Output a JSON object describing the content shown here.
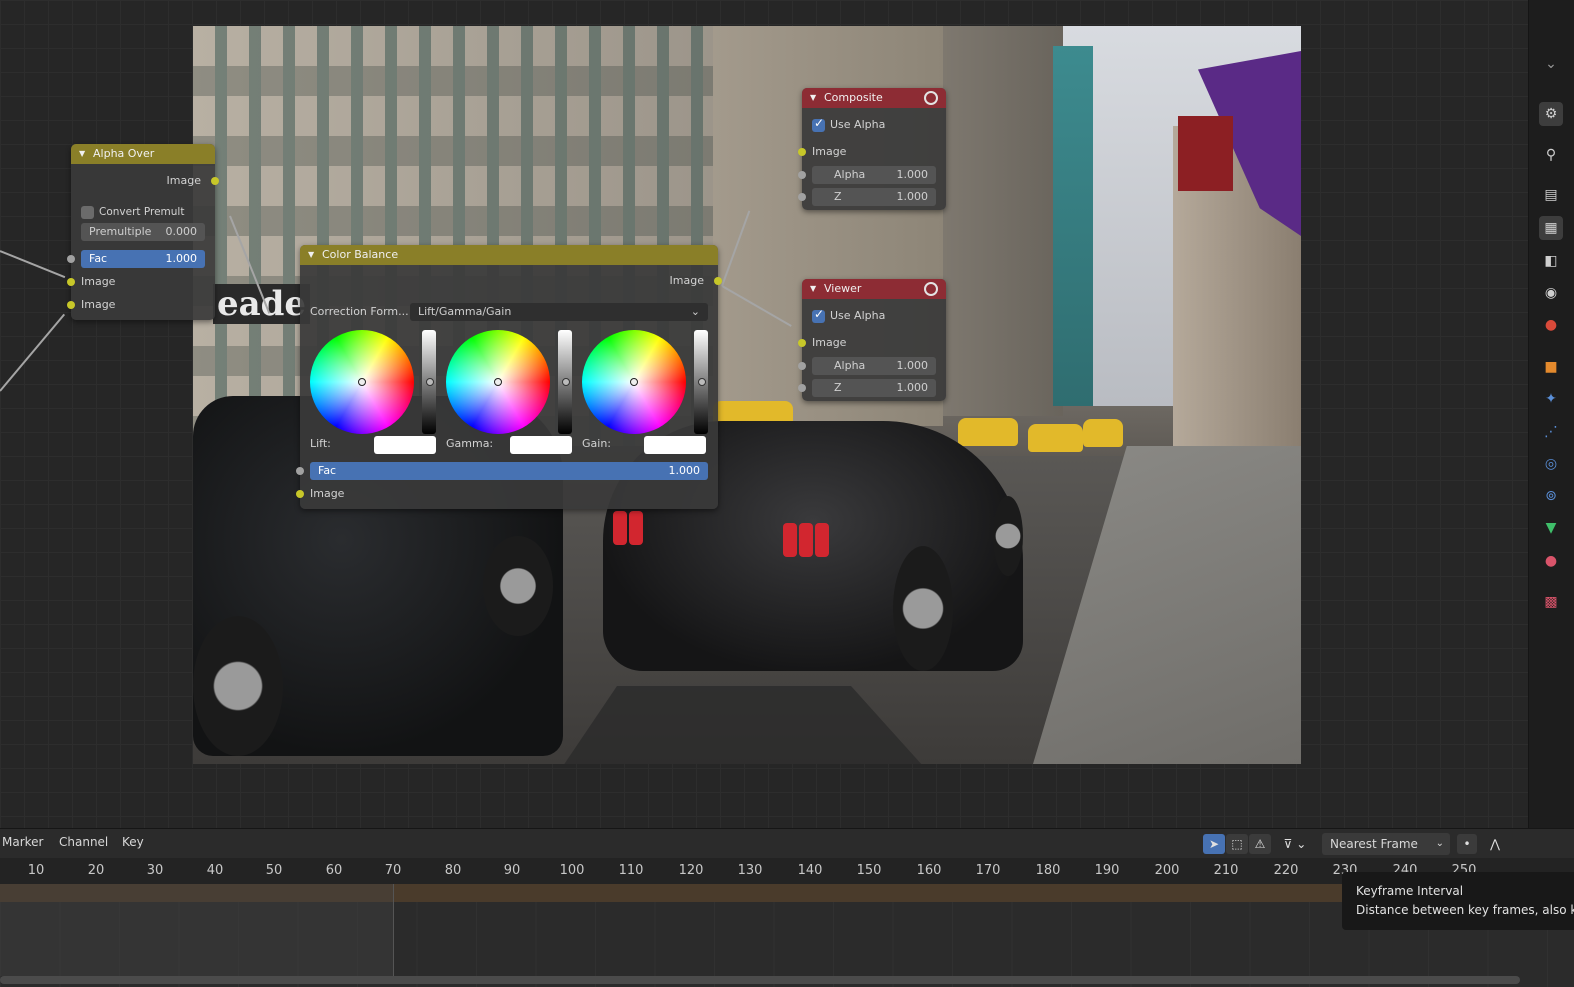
{
  "nodes": {
    "alpha_over": {
      "title": "Alpha Over",
      "output_image": "Image",
      "convert_premult_label": "Convert Premult",
      "premultiple_label": "Premultiple",
      "premultiple_value": "0.000",
      "fac_label": "Fac",
      "fac_value": "1.000",
      "input_image_1": "Image",
      "input_image_2": "Image"
    },
    "composite": {
      "title": "Composite",
      "use_alpha_label": "Use Alpha",
      "image_label": "Image",
      "alpha_label": "Alpha",
      "alpha_value": "1.000",
      "z_label": "Z",
      "z_value": "1.000"
    },
    "viewer": {
      "title": "Viewer",
      "use_alpha_label": "Use Alpha",
      "image_label": "Image",
      "alpha_label": "Alpha",
      "alpha_value": "1.000",
      "z_label": "Z",
      "z_value": "1.000"
    },
    "color_balance": {
      "title": "Color Balance",
      "output_image": "Image",
      "correction_label": "Correction Form...",
      "correction_value": "Lift/Gamma/Gain",
      "lift_label": "Lift:",
      "gamma_label": "Gamma:",
      "gain_label": "Gain:",
      "fac_label": "Fac",
      "fac_value": "1.000",
      "input_image": "Image"
    }
  },
  "backdrop": {
    "sign_text": "eade"
  },
  "right_toolbar": {
    "icons": [
      "tool-icon",
      "render-icon",
      "output-icon",
      "view-layer-icon",
      "scene-icon",
      "world-icon",
      "object-icon",
      "modifier-icon",
      "particles-icon",
      "physics-icon",
      "constraints-icon",
      "data-icon",
      "material-icon",
      "texture-icon"
    ]
  },
  "timeline": {
    "menu": [
      "Marker",
      "Channel",
      "Key"
    ],
    "snap_mode": "Nearest Frame",
    "ticks": [
      "10",
      "20",
      "30",
      "40",
      "50",
      "60",
      "70",
      "80",
      "90",
      "100",
      "110",
      "120",
      "130",
      "140",
      "150",
      "160",
      "170",
      "180",
      "190",
      "200",
      "210",
      "220",
      "230",
      "240",
      "250"
    ]
  },
  "tooltip": {
    "title": "Keyframe Interval",
    "description": "Distance between key frames, also k"
  },
  "colors": {
    "node_header_yellow": "#8a7f28",
    "node_header_red": "#8d2c34",
    "accent_blue": "#4772b3",
    "socket_yellow": "#c7c729"
  }
}
